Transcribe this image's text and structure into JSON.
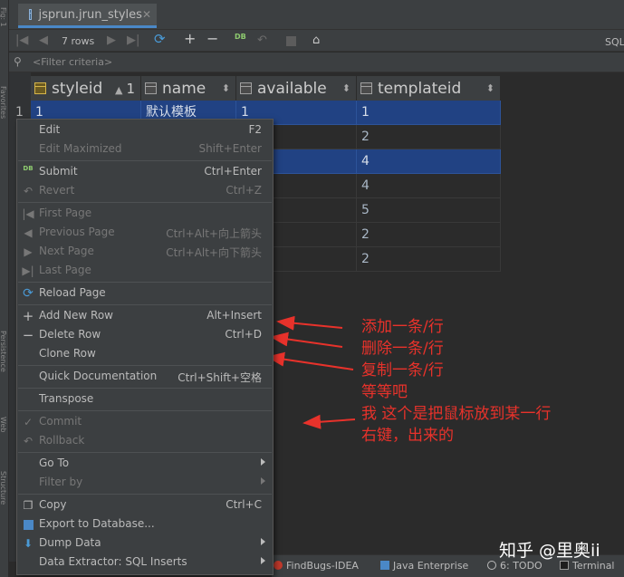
{
  "side_strip": [
    "Fig: 1",
    "Favorites",
    "Persistence",
    "Web",
    "Structure"
  ],
  "tab": {
    "label": "jsprun.jrun_styles",
    "close": "✕"
  },
  "toolbar": {
    "first": "|◀",
    "prev": "◀",
    "rows": "7 rows",
    "next": "▶",
    "last": "▶|",
    "reload": "⟳",
    "add": "+",
    "delete": "−",
    "db": "DB",
    "undo": "↶",
    "lock": "⌂",
    "sql": "SQL"
  },
  "filter": {
    "icon": "⚲",
    "placeholder": "<Filter criteria>"
  },
  "columns": [
    {
      "name": "styleid",
      "sort": "▲",
      "sort_order": "1"
    },
    {
      "name": "name",
      "sort": "⬍"
    },
    {
      "name": "available",
      "sort": "⬍"
    },
    {
      "name": "templateid",
      "sort": "⬍"
    }
  ],
  "rows": [
    {
      "num": "1",
      "styleid": "1",
      "name": "默认模板",
      "available": "1",
      "templateid": "1",
      "selected": true
    },
    {
      "num": "",
      "styleid": "",
      "name": "",
      "available": "",
      "templateid": "2",
      "selected": false
    },
    {
      "num": "",
      "styleid": "",
      "name": "",
      "available": "",
      "templateid": "4",
      "selected": true
    },
    {
      "num": "",
      "styleid": "",
      "name": "",
      "available": "",
      "templateid": "4",
      "selected": false
    },
    {
      "num": "",
      "styleid": "",
      "name": "",
      "available": "",
      "templateid": "5",
      "selected": false
    },
    {
      "num": "",
      "styleid": "",
      "name": "",
      "available": "",
      "templateid": "2",
      "selected": false
    },
    {
      "num": "",
      "styleid": "",
      "name": "",
      "available": "",
      "templateid": "2",
      "selected": false
    }
  ],
  "menu": {
    "edit": {
      "label": "Edit",
      "shortcut": "F2"
    },
    "edit_max": {
      "label": "Edit Maximized",
      "shortcut": "Shift+Enter"
    },
    "submit": {
      "label": "Submit",
      "shortcut": "Ctrl+Enter",
      "icon": "DB"
    },
    "revert": {
      "label": "Revert",
      "shortcut": "Ctrl+Z",
      "icon": "↶"
    },
    "first_page": {
      "label": "First Page",
      "icon": "|◀"
    },
    "prev_page": {
      "label": "Previous Page",
      "shortcut": "Ctrl+Alt+向上箭头",
      "icon": "◀"
    },
    "next_page": {
      "label": "Next Page",
      "shortcut": "Ctrl+Alt+向下箭头",
      "icon": "▶"
    },
    "last_page": {
      "label": "Last Page",
      "icon": "▶|"
    },
    "reload": {
      "label": "Reload Page",
      "icon": "⟳"
    },
    "add_row": {
      "label": "Add New Row",
      "shortcut": "Alt+Insert",
      "icon": "+"
    },
    "delete_row": {
      "label": "Delete Row",
      "shortcut": "Ctrl+D",
      "icon": "−"
    },
    "clone_row": {
      "label": "Clone Row"
    },
    "quick_doc": {
      "label": "Quick Documentation",
      "shortcut": "Ctrl+Shift+空格"
    },
    "transpose": {
      "label": "Transpose"
    },
    "commit": {
      "label": "Commit",
      "icon": "✓"
    },
    "rollback": {
      "label": "Rollback",
      "icon": "↶"
    },
    "goto": {
      "label": "Go To"
    },
    "filter_by": {
      "label": "Filter by"
    },
    "copy": {
      "label": "Copy",
      "shortcut": "Ctrl+C",
      "icon": "❐"
    },
    "export": {
      "label": "Export to Database..."
    },
    "dump": {
      "label": "Dump Data",
      "icon": "⬇"
    },
    "extractor": {
      "label": "Data Extractor: SQL Inserts"
    }
  },
  "annotations": {
    "add": "添加一条/行",
    "delete": "删除一条/行",
    "copy": "复制一条/行",
    "etc": "等等吧",
    "note1": "我 这个是把鼠标放到某一行",
    "note2": "右键，出来的"
  },
  "statusbar": {
    "findbugs": "FindBugs-IDEA",
    "java_ee": "Java Enterprise",
    "todo": "6: TODO",
    "terminal": "Terminal"
  },
  "watermark": "知乎 @里奥ii",
  "colors": {
    "accent": "#4a88c7",
    "selection": "#214283",
    "annotation": "#e8322b",
    "panel": "#3c3f41",
    "editor": "#2b2b2b"
  }
}
